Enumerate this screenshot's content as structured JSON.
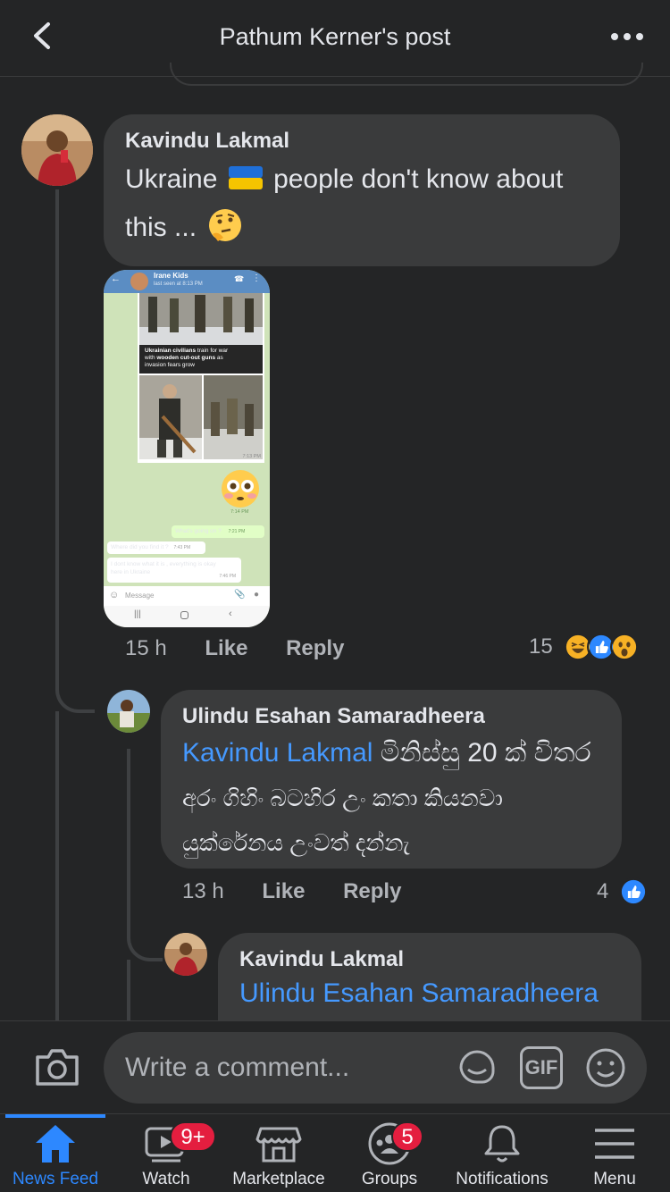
{
  "header": {
    "title": "Pathum Kerner's post"
  },
  "comments": [
    {
      "author": "Kavindu Lakmal",
      "text_line1_a": "Ukraine",
      "text_line1_b": "people don't know about",
      "text_line2": "this ...",
      "time": "15 h",
      "like": "Like",
      "reply": "Reply",
      "reaction_count": "15"
    },
    {
      "author": "Ulindu Esahan Samaradheera",
      "mention": "Kavindu Lakmal",
      "text_line1": "මිනිස්සු 20 ක් විතර",
      "text_line2": "අරං ගිහිං බටහිර උං කතා කියනවා",
      "text_line3": "යුක්රේනය උංවත්  දන්නැ",
      "time": "13 h",
      "like": "Like",
      "reply": "Reply",
      "reaction_count": "4"
    },
    {
      "author": "Kavindu Lakmal",
      "mention": "Ulindu Esahan Samaradheera"
    }
  ],
  "attached_screenshot": {
    "chat_name": "Irane Kids",
    "last_seen": "last seen at 8:13 PM",
    "caption_bold1": "Ukrainian civilians",
    "caption_rest1": " train for war",
    "caption_line2a": "with ",
    "caption_bold2": "wooden cut-out guns",
    "caption_rest2": " as",
    "caption_line3": "invasion fears grow",
    "time1": "7:13 PM",
    "time2": "7:14 PM",
    "msg_out": "What's going on ?",
    "time3": "7:21 PM",
    "msg_in1": "Where did you find it ?",
    "time4": "7:43 PM",
    "msg_in2a": "I dont know what it is , everything is okay",
    "msg_in2b": "here in Ukraine",
    "time5": "7:46 PM",
    "input_placeholder": "Message"
  },
  "composer": {
    "placeholder": "Write a comment...",
    "gif_label": "GIF"
  },
  "tabs": [
    {
      "label": "News Feed",
      "icon": "home-icon"
    },
    {
      "label": "Watch",
      "icon": "watch-icon",
      "badge": "9+"
    },
    {
      "label": "Marketplace",
      "icon": "marketplace-icon"
    },
    {
      "label": "Groups",
      "icon": "groups-icon",
      "badge": "5"
    },
    {
      "label": "Notifications",
      "icon": "bell-icon"
    },
    {
      "label": "Menu",
      "icon": "menu-icon"
    }
  ],
  "colors": {
    "background": "#242526",
    "bubble": "#3a3b3c",
    "accent": "#2d88ff",
    "mention": "#4599ff",
    "badge": "#e41e3f"
  }
}
